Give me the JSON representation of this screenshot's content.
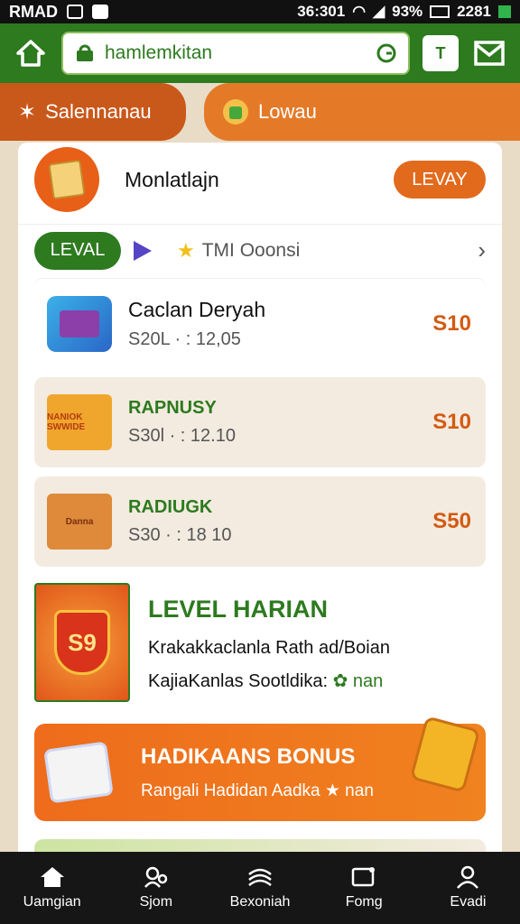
{
  "status_bar": {
    "carrier": "RMAD",
    "time": "36:301",
    "battery_pct": "93%",
    "extra": "2281"
  },
  "top_nav": {
    "search_text": "hamlemkitan",
    "square_btn_label": "T"
  },
  "tabs": [
    {
      "label": "Salennanau"
    },
    {
      "label": "Lowau"
    }
  ],
  "profile": {
    "name": "Monlatlajn",
    "action_label": "LEVAY"
  },
  "level_row": {
    "badge": "LEVAL",
    "text": "TMI Ooonsi"
  },
  "items": [
    {
      "title": "Caclan Deryah",
      "sub": "S20L · : 12,05",
      "price": "S10"
    },
    {
      "title": "RAPNUSY",
      "sub": "S30l · : 12.10",
      "price": "S10",
      "thumb_text": "NANIOK SWWIDE"
    },
    {
      "title": "RADIUGK",
      "sub": "S30 · : 18 10",
      "price": "S50",
      "thumb_text": "Danna"
    }
  ],
  "level_card": {
    "title": "LEVEL HARIAN",
    "line1": "Krakakkaclanla Rath ad/Boian",
    "line2_prefix": "KajiaKanlas Sootldika:",
    "line2_suffix": "nan",
    "shield_text": "S9"
  },
  "bonus": {
    "title": "HADIKAANS BONUS",
    "sub": "Rangali Hadidan Aadka ★ nan"
  },
  "bottom_nav": [
    {
      "label": "Uamgian",
      "icon": "home-icon"
    },
    {
      "label": "Sjom",
      "icon": "user-search-icon"
    },
    {
      "label": "Bexoniah",
      "icon": "stack-icon"
    },
    {
      "label": "Fomg",
      "icon": "message-icon"
    },
    {
      "label": "Evadi",
      "icon": "profile-icon"
    }
  ],
  "colors": {
    "primary_green": "#2d7a1f",
    "accent_orange": "#e26a1c",
    "price_orange": "#d35a11"
  }
}
